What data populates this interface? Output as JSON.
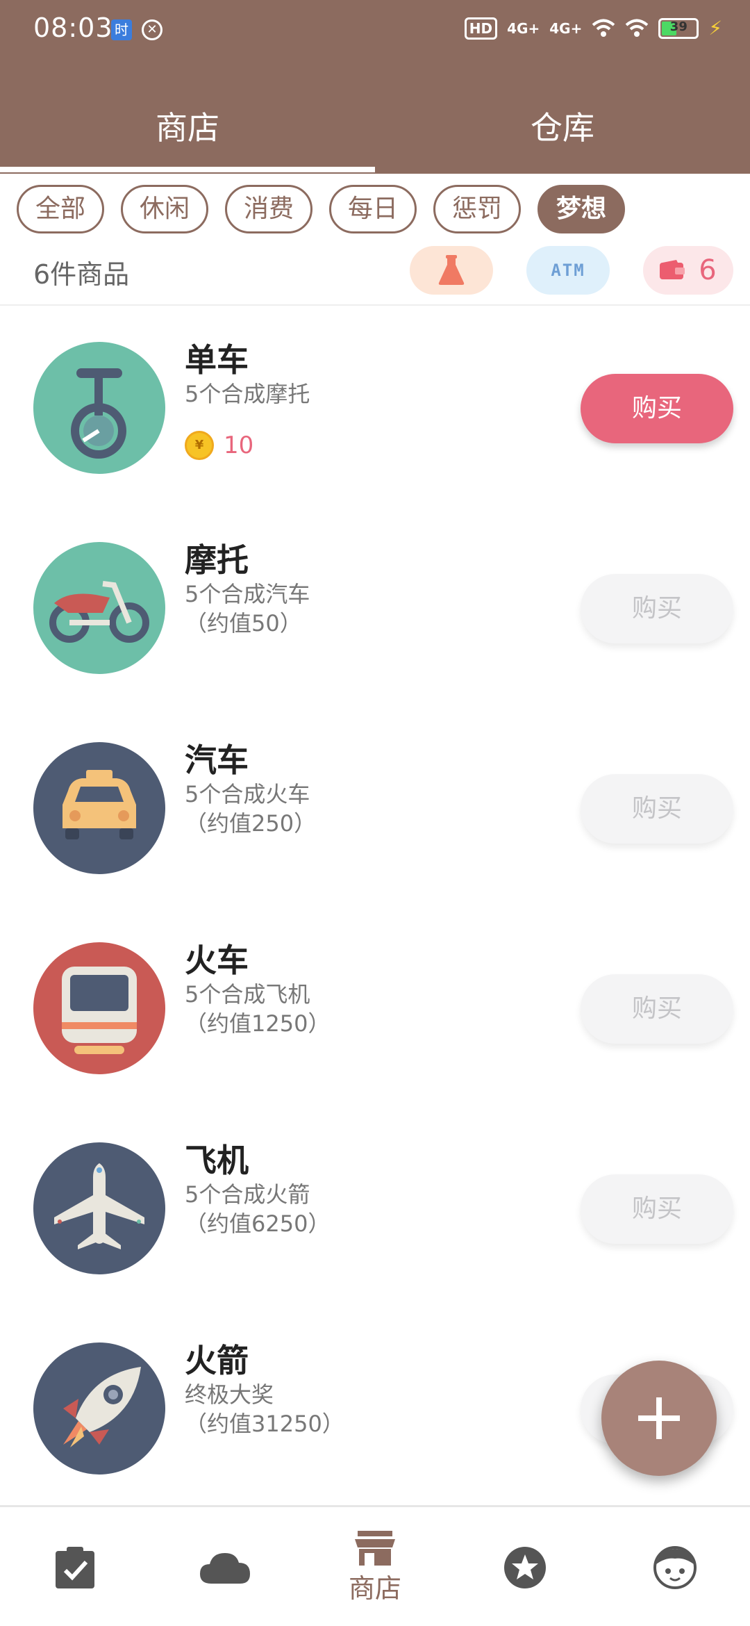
{
  "status_bar": {
    "time": "08:03",
    "hd": "HD",
    "sig1": "4G+",
    "sig2": "4G+",
    "battery": "39"
  },
  "top_tabs": [
    {
      "label": "商店",
      "active": true
    },
    {
      "label": "仓库",
      "active": false
    }
  ],
  "filters": [
    {
      "label": "全部",
      "active": false
    },
    {
      "label": "休闲",
      "active": false
    },
    {
      "label": "消费",
      "active": false
    },
    {
      "label": "每日",
      "active": false
    },
    {
      "label": "惩罚",
      "active": false
    },
    {
      "label": "梦想",
      "active": true
    }
  ],
  "summary": {
    "count_text": "6件商品",
    "atm_label": "ATM",
    "wallet_value": "6"
  },
  "items": [
    {
      "title": "单车",
      "desc1": "5个合成摩托",
      "desc2": "",
      "price": "10",
      "buy_label": "购买",
      "enabled": true,
      "bg": "#6dbfa8"
    },
    {
      "title": "摩托",
      "desc1": "5个合成汽车",
      "desc2": "（约值50）",
      "price": "",
      "buy_label": "购买",
      "enabled": false,
      "bg": "#6dbfa8"
    },
    {
      "title": "汽车",
      "desc1": "5个合成火车",
      "desc2": "（约值250）",
      "price": "",
      "buy_label": "购买",
      "enabled": false,
      "bg": "#4e5b73"
    },
    {
      "title": "火车",
      "desc1": "5个合成飞机",
      "desc2": "（约值1250）",
      "price": "",
      "buy_label": "购买",
      "enabled": false,
      "bg": "#c95a55"
    },
    {
      "title": "飞机",
      "desc1": "5个合成火箭",
      "desc2": "（约值6250）",
      "price": "",
      "buy_label": "购买",
      "enabled": false,
      "bg": "#4e5b73"
    },
    {
      "title": "火箭",
      "desc1": "终极大奖",
      "desc2": "（约值31250）",
      "price": "",
      "buy_label": "",
      "enabled": false,
      "bg": "#4e5b73"
    }
  ],
  "coin_symbol": "¥",
  "bottom_nav": {
    "store_label": "商店"
  },
  "colors": {
    "primary": "#8c6b5f",
    "accent": "#e8667c",
    "fab": "#a88379"
  }
}
